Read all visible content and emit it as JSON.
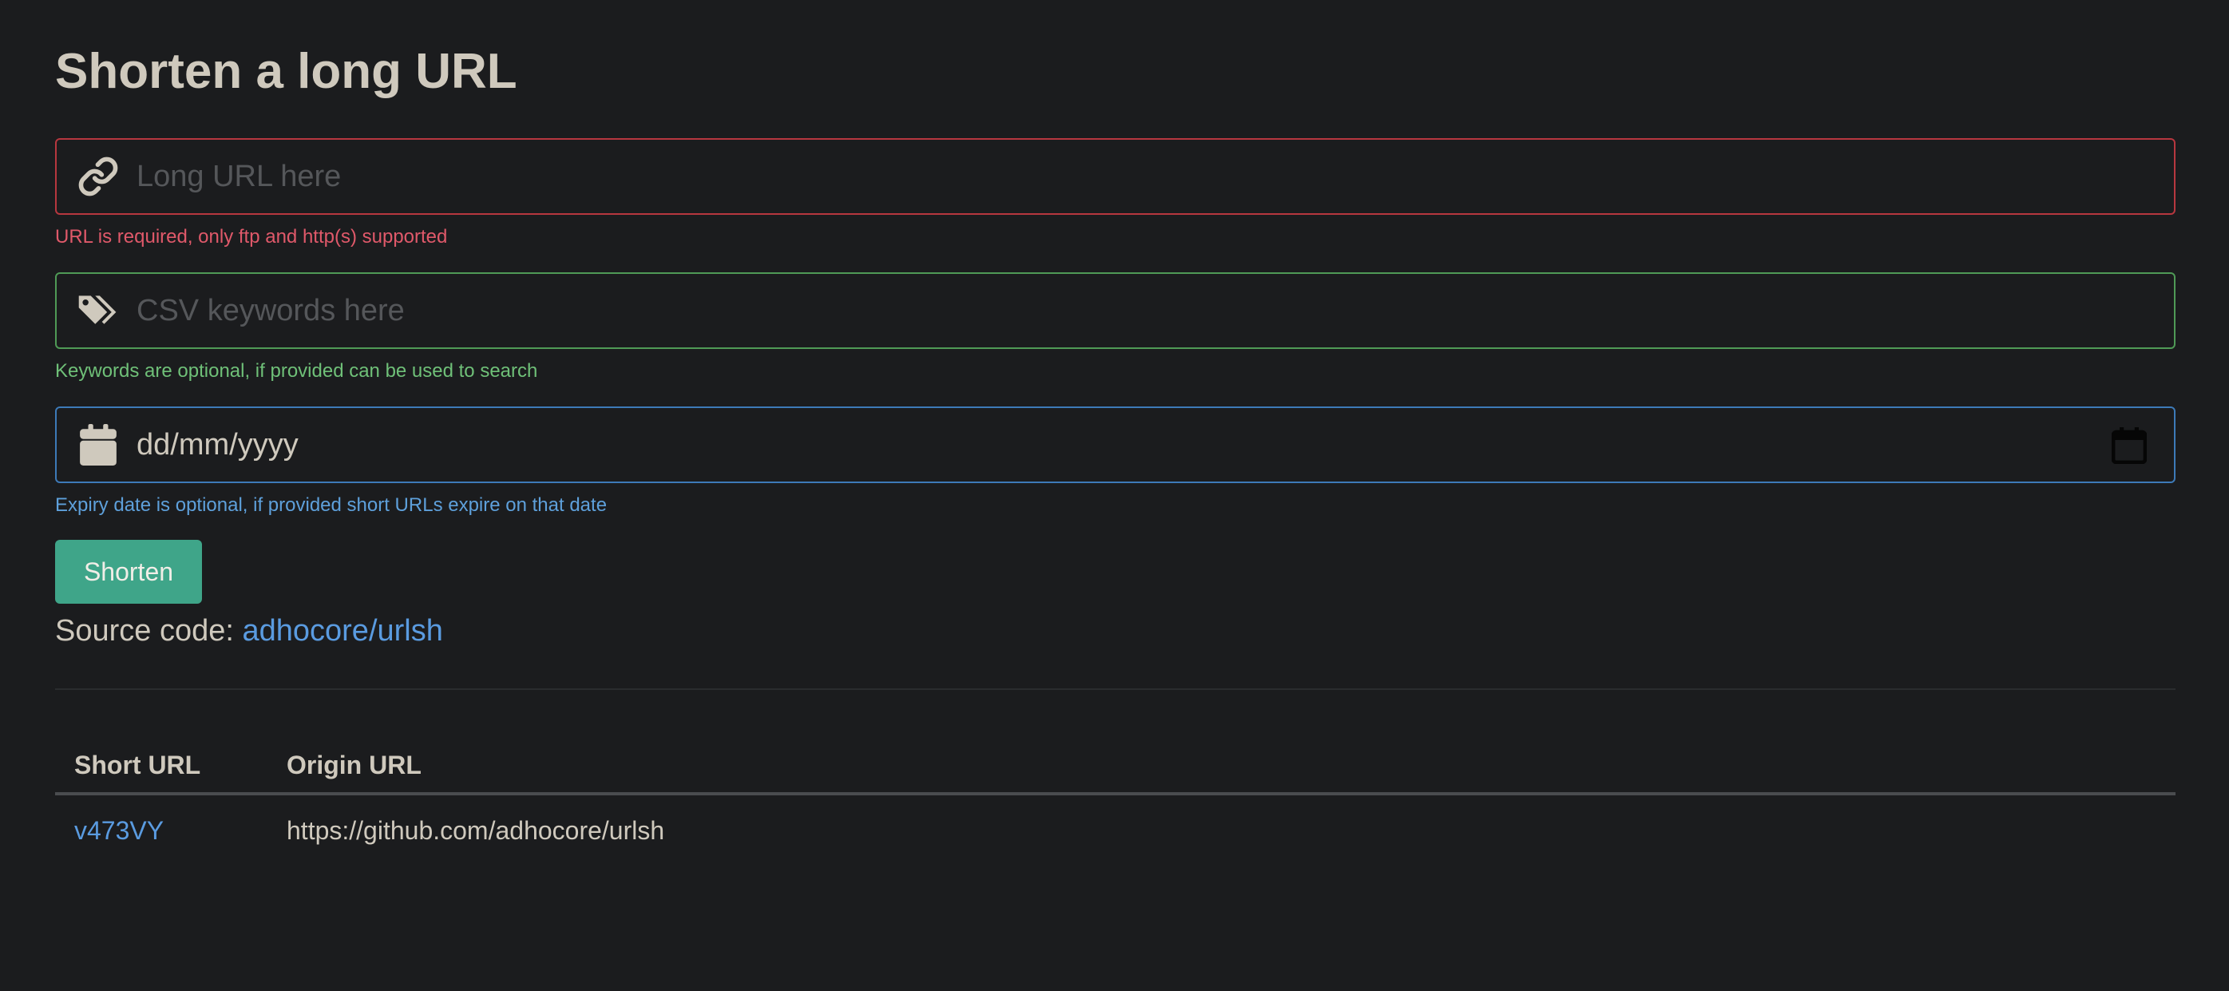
{
  "page": {
    "title": "Shorten a long URL"
  },
  "form": {
    "url": {
      "icon": "link-icon",
      "placeholder": "Long URL here",
      "help": "URL is required, only ftp and http(s) supported"
    },
    "keywords": {
      "icon": "tags-icon",
      "placeholder": "CSV keywords here",
      "help": "Keywords are optional, if provided can be used to search"
    },
    "expiry": {
      "icon": "calendar-icon",
      "value": "dd/mm/yyyy",
      "help": "Expiry date is optional, if provided short URLs expire on that date"
    },
    "submit_label": "Shorten"
  },
  "source": {
    "label": "Source code:",
    "link_text": "adhocore/urlsh"
  },
  "table": {
    "headers": [
      "Short URL",
      "Origin URL"
    ],
    "rows": [
      {
        "short": "v473VY",
        "origin": "https://github.com/adhocore/urlsh"
      }
    ]
  },
  "colors": {
    "error": "#e0596a",
    "success": "#6fc078",
    "info": "#5ea0db",
    "button": "#3fa589",
    "link": "#5a9be0"
  }
}
